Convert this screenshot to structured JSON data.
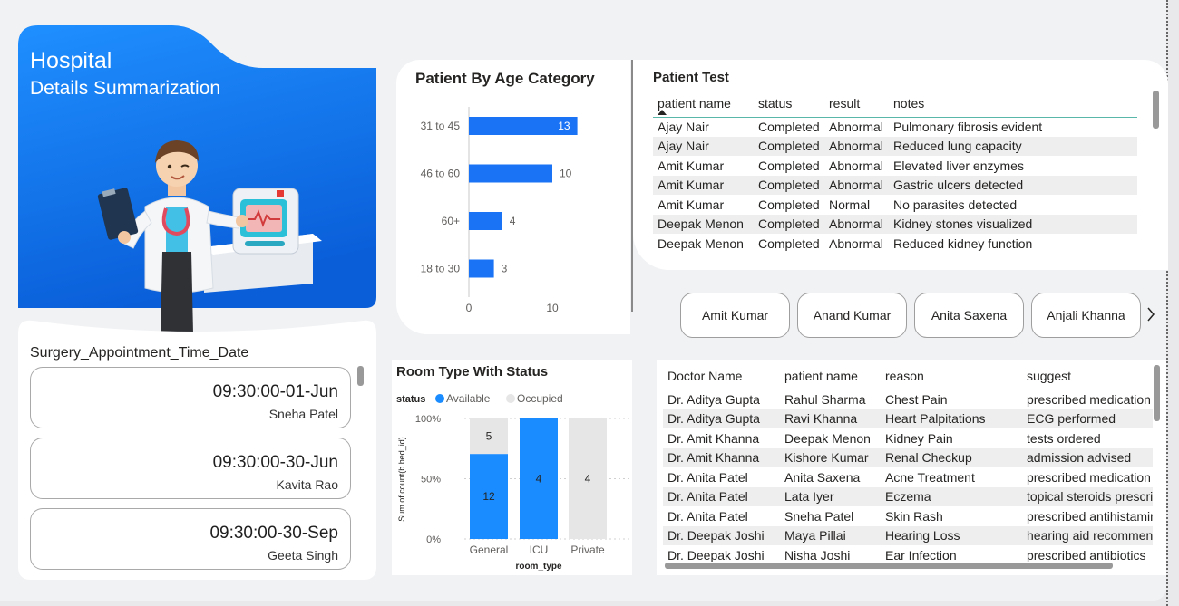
{
  "hero": {
    "title": "Hospital",
    "subtitle": "Details Summarization"
  },
  "surgery": {
    "title": "Surgery_Appointment_Time_Date",
    "appointments": [
      {
        "time": "09:30:00-01-Jun",
        "name": "Sneha Patel"
      },
      {
        "time": "09:30:00-30-Jun",
        "name": "Kavita Rao"
      },
      {
        "time": "09:30:00-30-Sep",
        "name": "Geeta Singh"
      }
    ]
  },
  "age_chart_title": "Patient By Age Category",
  "room_chart_title": "Room Type With Status",
  "chart_data": [
    {
      "type": "bar",
      "orientation": "horizontal",
      "title": "Patient By Age Category",
      "categories": [
        "31 to 45",
        "46 to 60",
        "60+",
        "18 to 30"
      ],
      "values": [
        13,
        10,
        4,
        3
      ],
      "xticks": [
        "0",
        "10"
      ],
      "xlim": [
        0,
        13.5
      ],
      "color": "#1a73f5",
      "grid": false
    },
    {
      "type": "bar",
      "stacked": "percent",
      "title": "Room Type With Status",
      "categories": [
        "General",
        "ICU",
        "Private"
      ],
      "series": [
        {
          "name": "Available",
          "values": [
            12,
            4,
            0
          ],
          "color": "#1a8cff"
        },
        {
          "name": "Occupied",
          "values": [
            5,
            0,
            4
          ],
          "color": "#e6e6e6"
        }
      ],
      "legend_title": "status",
      "legend_position": "top-left",
      "xlabel": "room_type",
      "ylabel": "Sum of count(b.bed_id)",
      "yticks": [
        "100%",
        "50%",
        "0%"
      ],
      "grid": true
    }
  ],
  "patient_test": {
    "title": "Patient Test",
    "columns": [
      "patient name",
      "status",
      "result",
      "notes"
    ],
    "sort_icon": "sort-ascending-icon",
    "rows": [
      [
        "Ajay Nair",
        "Completed",
        "Abnormal",
        "Pulmonary fibrosis evident"
      ],
      [
        "Ajay Nair",
        "Completed",
        "Abnormal",
        "Reduced lung capacity"
      ],
      [
        "Amit Kumar",
        "Completed",
        "Abnormal",
        "Elevated liver enzymes"
      ],
      [
        "Amit Kumar",
        "Completed",
        "Abnormal",
        "Gastric ulcers detected"
      ],
      [
        "Amit Kumar",
        "Completed",
        "Normal",
        "No parasites detected"
      ],
      [
        "Deepak Menon",
        "Completed",
        "Abnormal",
        "Kidney stones visualized"
      ],
      [
        "Deepak Menon",
        "Completed",
        "Abnormal",
        "Reduced kidney function"
      ]
    ]
  },
  "patient_slicer": {
    "buttons": [
      "Amit Kumar",
      "Anand Kumar",
      "Anita Saxena",
      "Anjali Khanna"
    ],
    "next_icon": "chevron-right-icon"
  },
  "doctor_table": {
    "columns": [
      "Doctor Name",
      "patient name",
      "reason",
      "suggest"
    ],
    "rows": [
      [
        "Dr. Aditya Gupta",
        "Rahul Sharma",
        "Chest Pain",
        "prescribed medication"
      ],
      [
        "Dr. Aditya Gupta",
        "Ravi Khanna",
        "Heart Palpitations",
        "ECG performed"
      ],
      [
        "Dr. Amit Khanna",
        "Deepak Menon",
        "Kidney Pain",
        "tests ordered"
      ],
      [
        "Dr. Amit Khanna",
        "Kishore Kumar",
        "Renal Checkup",
        "admission advised"
      ],
      [
        "Dr. Anita Patel",
        "Anita Saxena",
        "Acne Treatment",
        "prescribed medication"
      ],
      [
        "Dr. Anita Patel",
        "Lata Iyer",
        "Eczema",
        "topical steroids prescribed"
      ],
      [
        "Dr. Anita Patel",
        "Sneha Patel",
        "Skin Rash",
        "prescribed antihistamines"
      ],
      [
        "Dr. Deepak Joshi",
        "Maya Pillai",
        "Hearing Loss",
        "hearing aid recommended"
      ],
      [
        "Dr. Deepak Joshi",
        "Nisha Joshi",
        "Ear Infection",
        "prescribed antibiotics"
      ]
    ]
  },
  "colors": {
    "accent": "#1a73f5",
    "hero_top": "#1e90ff",
    "hero_bottom": "#0a5fd9",
    "occupied": "#e6e6e6"
  }
}
